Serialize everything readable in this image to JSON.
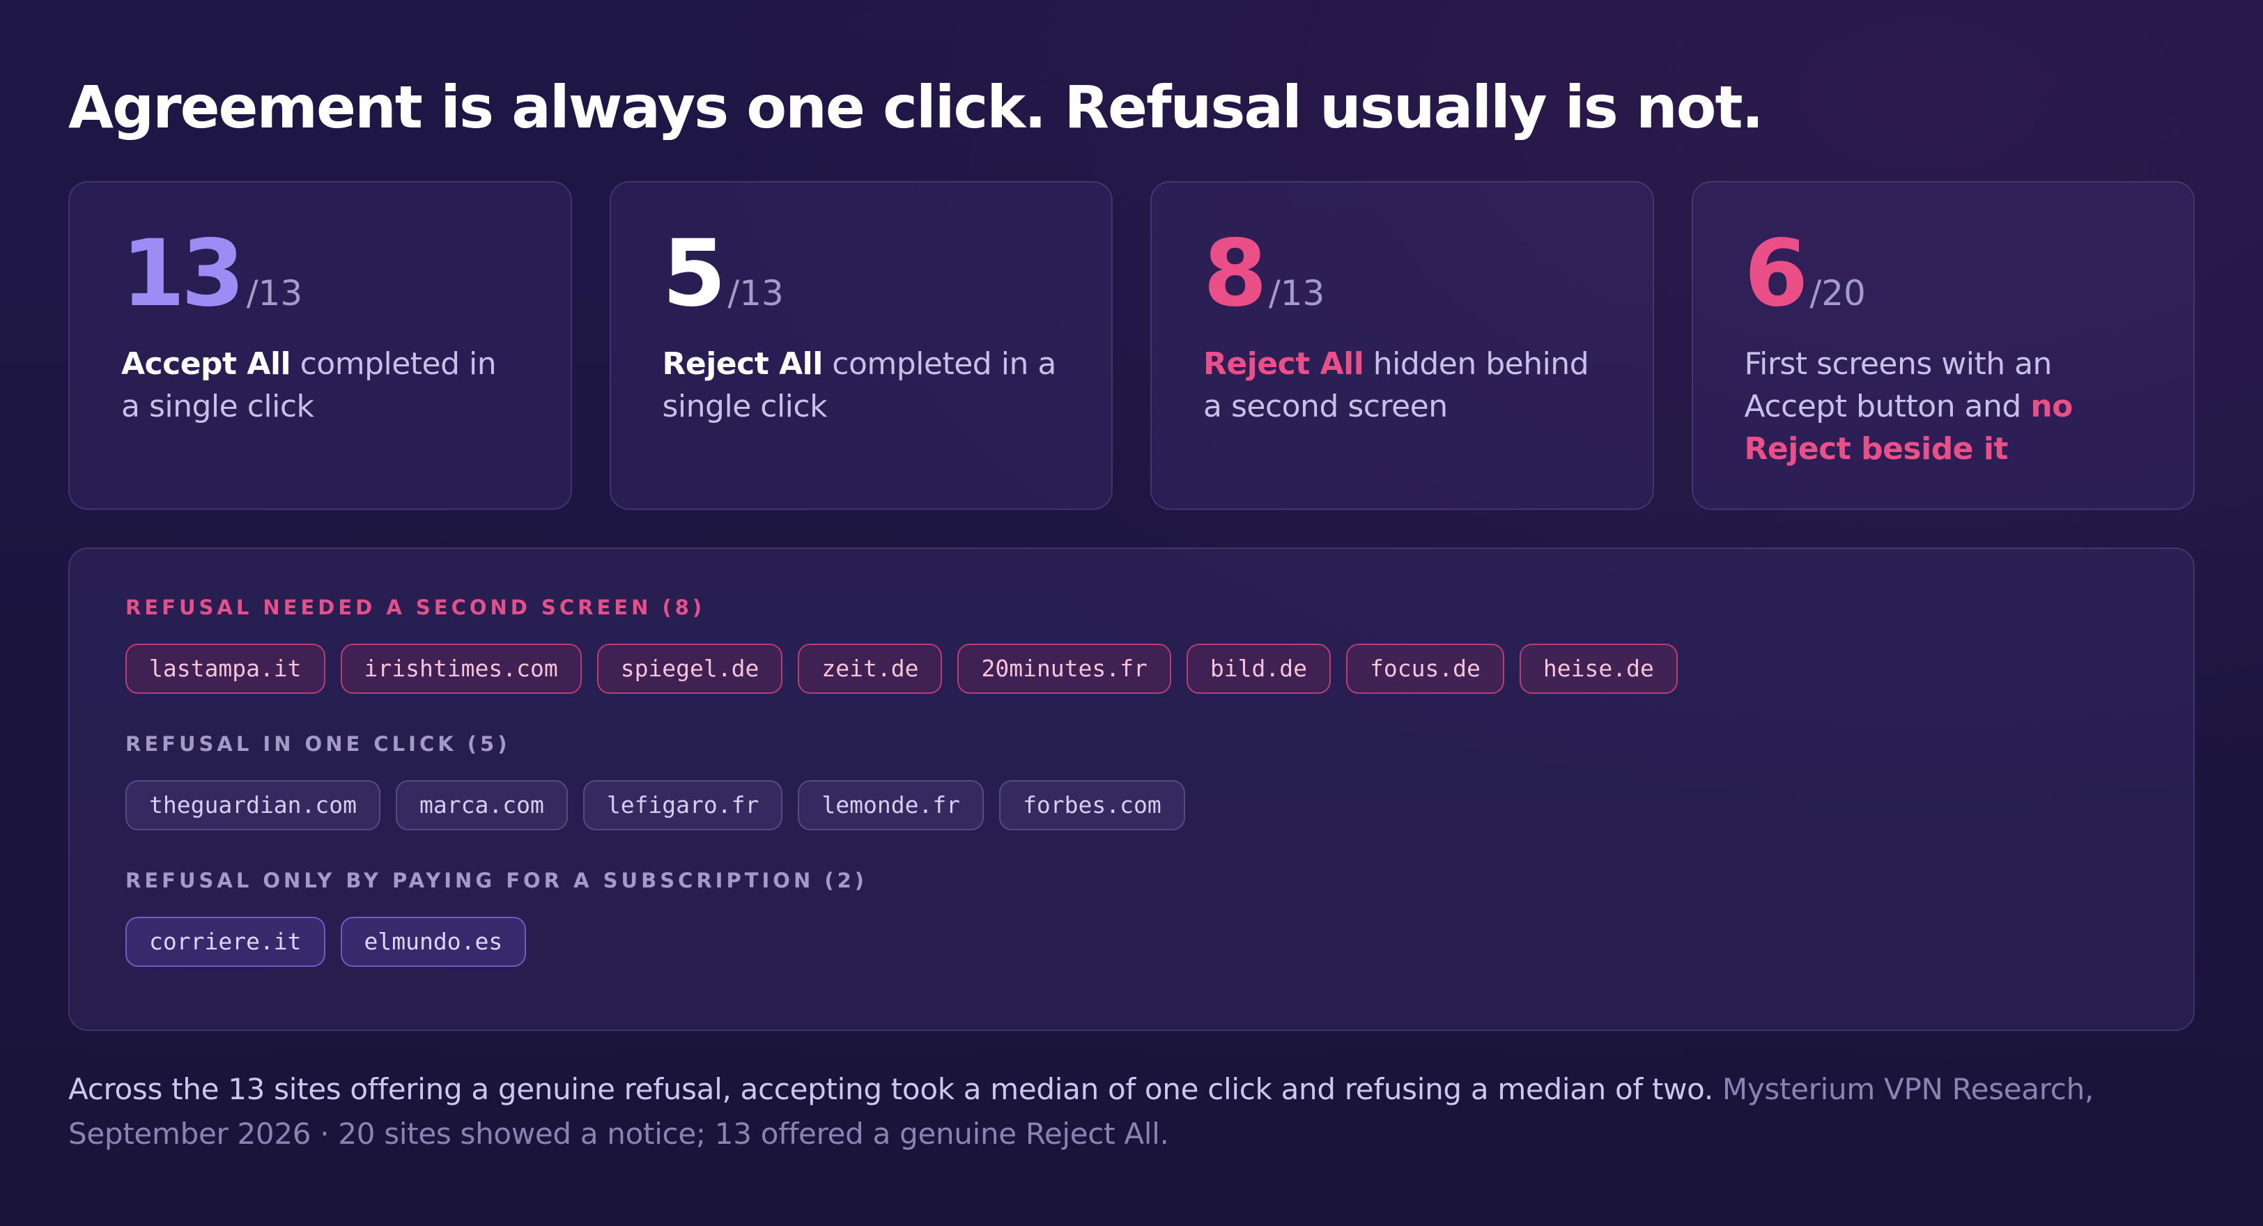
{
  "title": "Agreement is always one click. Refusal usually is not.",
  "colors": {
    "accent_violet": "#9d8cf4",
    "accent_pink": "#ea4f88",
    "background": "#1e1643"
  },
  "stats": [
    {
      "value": "13",
      "denominator": "/13",
      "highlight": "Accept All",
      "text": " completed in a single click"
    },
    {
      "value": "5",
      "denominator": "/13",
      "highlight": "Reject All",
      "text": " completed in a single click"
    },
    {
      "value": "8",
      "denominator": "/13",
      "highlight": "Reject All",
      "text": " hidden behind a second screen"
    },
    {
      "value": "6",
      "denominator": "/20",
      "text": "First screens with an Accept button and ",
      "highlight": "no Reject beside it"
    }
  ],
  "groups": [
    {
      "heading": "REFUSAL NEEDED A SECOND SCREEN (8)",
      "sites": [
        "lastampa.it",
        "irishtimes.com",
        "spiegel.de",
        "zeit.de",
        "20minutes.fr",
        "bild.de",
        "focus.de",
        "heise.de"
      ]
    },
    {
      "heading": "REFUSAL IN ONE CLICK (5)",
      "sites": [
        "theguardian.com",
        "marca.com",
        "lefigaro.fr",
        "lemonde.fr",
        "forbes.com"
      ]
    },
    {
      "heading": "REFUSAL ONLY BY PAYING FOR A SUBSCRIPTION (2)",
      "sites": [
        "corriere.it",
        "elmundo.es"
      ]
    }
  ],
  "footnote": {
    "main": "Across the 13 sites offering a genuine refusal, accepting took a median of one click and refusing a median of two.",
    "source": " Mysterium VPN Research, September 2026 · 20 sites showed a notice; 13 offered a genuine Reject All."
  }
}
